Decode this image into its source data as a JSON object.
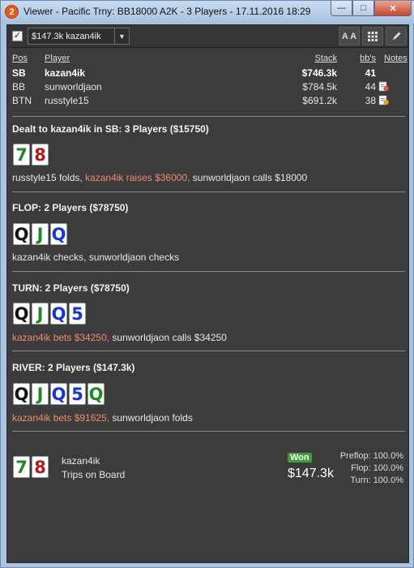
{
  "window": {
    "app_badge": "2",
    "title": "Viewer - Pacific Trny: BB18000 A2K - 3 Players - 17.11.2016 18:29"
  },
  "toolbar": {
    "hand_select": "$147.3k kazan4ik",
    "font_button": "A A"
  },
  "players_table": {
    "headers": {
      "pos": "Pos",
      "player": "Player",
      "stack": "Stack",
      "bbs": "bb's",
      "notes": "Notes"
    },
    "rows": [
      {
        "pos": "SB",
        "player": "kazan4ik",
        "stack": "$746.3k",
        "bbs": "41"
      },
      {
        "pos": "BB",
        "player": "sunworldjaon",
        "stack": "$784.5k",
        "bbs": "44"
      },
      {
        "pos": "BTN",
        "player": "russtyle15",
        "stack": "$691.2k",
        "bbs": "38"
      }
    ]
  },
  "preflop": {
    "title": "Dealt to kazan4ik in SB: 3 Players ($15750)",
    "cards": [
      "7",
      "8"
    ],
    "actions": [
      "russtyle15 folds, ",
      "kazan4ik raises $36000, ",
      "sunworldjaon calls $18000"
    ]
  },
  "flop": {
    "title": "FLOP: 2 Players ($78750)",
    "cards": [
      "Q",
      "J",
      "Q"
    ],
    "actions": "kazan4ik checks, sunworldjaon checks"
  },
  "turn": {
    "title": "TURN: 2 Players ($78750)",
    "cards": [
      "Q",
      "J",
      "Q",
      "5"
    ],
    "actions": [
      "kazan4ik bets $34250, ",
      "sunworldjaon calls $34250"
    ]
  },
  "river": {
    "title": "RIVER: 2 Players ($147.3k)",
    "cards": [
      "Q",
      "J",
      "Q",
      "5",
      "Q"
    ],
    "actions": [
      "kazan4ik bets $91625, ",
      "sunworldjaon folds"
    ]
  },
  "summary": {
    "cards": [
      "7",
      "8"
    ],
    "player": "kazan4ik",
    "hand": "Trips on Board",
    "won_badge": "Won",
    "won_amount": "$147.3k",
    "equity": [
      {
        "label": "Preflop:",
        "value": "100.0%"
      },
      {
        "label": "Flop:",
        "value": "100.0%"
      },
      {
        "label": "Turn:",
        "value": "100.0%"
      }
    ]
  },
  "colors": {
    "highlight_action": "#f08a74",
    "won_badge": "#3e9e3a",
    "card_green": "#1b8b22",
    "card_blue": "#1636c8",
    "card_red": "#b41818"
  }
}
